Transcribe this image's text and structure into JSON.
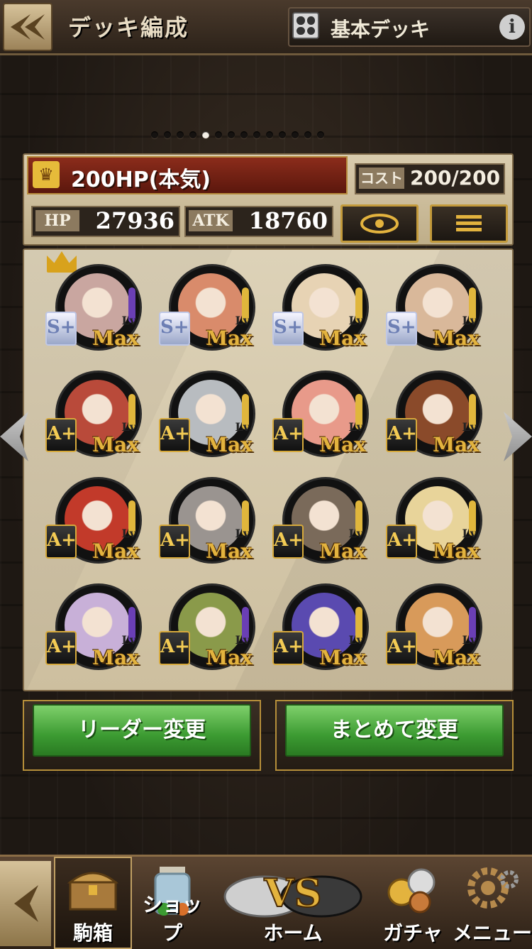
{
  "header": {
    "title": "デッキ編成",
    "deck_name": "基本デッキ",
    "info_symbol": "i"
  },
  "pager": {
    "count": 14,
    "active_index": 4
  },
  "deck": {
    "label": "200HP(本気)",
    "cost_label": "コスト",
    "cost_value": "200/200",
    "hp_label": "HP",
    "hp_value": "27936",
    "atk_label": "ATK",
    "atk_value": "18760"
  },
  "characters": [
    {
      "rank": "S+",
      "lv": "Lv.",
      "level": "Max",
      "leader": true,
      "face": "#c9a6a0",
      "arc": "purple"
    },
    {
      "rank": "S+",
      "lv": "Lv.",
      "level": "Max",
      "leader": false,
      "face": "#d98b6b",
      "arc": "gold"
    },
    {
      "rank": "S+",
      "lv": "Lv.",
      "level": "Max",
      "leader": false,
      "face": "#e7d3b4",
      "arc": "gold"
    },
    {
      "rank": "S+",
      "lv": "Lv.",
      "level": "Max",
      "leader": false,
      "face": "#d9b89a",
      "arc": "gold"
    },
    {
      "rank": "A+",
      "lv": "Lv.",
      "level": "Max",
      "leader": false,
      "face": "#b94a3a",
      "arc": "gold"
    },
    {
      "rank": "A+",
      "lv": "Lv.",
      "level": "Max",
      "leader": false,
      "face": "#b8bcc0",
      "arc": "gold"
    },
    {
      "rank": "A+",
      "lv": "Lv.",
      "level": "Max",
      "leader": false,
      "face": "#e89a8a",
      "arc": "gold"
    },
    {
      "rank": "A+",
      "lv": "Lv.",
      "level": "Max",
      "leader": false,
      "face": "#8a4a2a",
      "arc": "gold"
    },
    {
      "rank": "A+",
      "lv": "Lv.",
      "level": "Max",
      "leader": false,
      "face": "#c23a2a",
      "arc": "gold"
    },
    {
      "rank": "A+",
      "lv": "Lv.",
      "level": "Max",
      "leader": false,
      "face": "#9a9490",
      "arc": "gold"
    },
    {
      "rank": "A+",
      "lv": "Lv.",
      "level": "Max",
      "leader": false,
      "face": "#7a6a5a",
      "arc": "gold"
    },
    {
      "rank": "A+",
      "lv": "Lv.",
      "level": "Max",
      "leader": false,
      "face": "#e8d49a",
      "arc": "gold"
    },
    {
      "rank": "A+",
      "lv": "Lv.",
      "level": "Max",
      "leader": false,
      "face": "#c8b0d8",
      "arc": "purple"
    },
    {
      "rank": "A+",
      "lv": "Lv.",
      "level": "Max",
      "leader": false,
      "face": "#8a9a4a",
      "arc": "purple"
    },
    {
      "rank": "A+",
      "lv": "Lv.",
      "level": "Max",
      "leader": false,
      "face": "#5a4ab0",
      "arc": "gold"
    },
    {
      "rank": "A+",
      "lv": "Lv.",
      "level": "Max",
      "leader": false,
      "face": "#d89a5a",
      "arc": "purple"
    }
  ],
  "actions": {
    "change_leader": "リーダー変更",
    "bulk_change": "まとめて変更"
  },
  "footer": {
    "items": [
      {
        "label": "駒箱",
        "icon": "chest-icon",
        "active": true
      },
      {
        "label": "ショップ",
        "icon": "shop-jar-icon",
        "active": false
      },
      {
        "label": "ホーム",
        "icon": "vs-icon",
        "active": false,
        "badge": "VS"
      },
      {
        "label": "ガチャ",
        "icon": "coins-icon",
        "active": false
      },
      {
        "label": "メニュー",
        "icon": "gear-icon",
        "active": false
      }
    ]
  }
}
